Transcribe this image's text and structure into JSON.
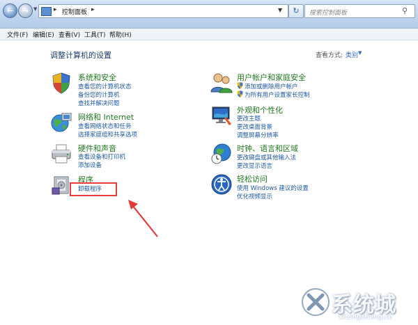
{
  "address_bar": {
    "path": "控制面板",
    "search_placeholder": "搜索控制面板"
  },
  "menu": [
    "文件(F)",
    "编辑(E)",
    "查看(V)",
    "工具(T)",
    "帮助(H)"
  ],
  "main": {
    "title": "调整计算机的设置",
    "view_by_label": "查看方式:",
    "view_by_value": "类别"
  },
  "categories": [
    {
      "title": "系统和安全",
      "icon": "shield-flag-icon",
      "links": [
        "查看您的计算机状态",
        "备份您的计算机",
        "查找并解决问题"
      ]
    },
    {
      "title": "网络和 Internet",
      "icon": "globe-network-icon",
      "links": [
        "查看网络状态和任务",
        "选择家庭组和共享选项"
      ]
    },
    {
      "title": "硬件和声音",
      "icon": "printer-icon",
      "links": [
        "查看设备和打印机",
        "添加设备"
      ]
    },
    {
      "title": "程序",
      "icon": "programs-icon",
      "links": [
        "卸载程序"
      ]
    },
    {
      "title": "用户帐户和家庭安全",
      "icon": "users-icon",
      "links": [
        "添加或删除用户帐户",
        "为所有用户设置家长控制"
      ]
    },
    {
      "title": "外观和个性化",
      "icon": "monitor-paint-icon",
      "links": [
        "更改主题",
        "更改桌面背景",
        "调整屏幕分辨率"
      ]
    },
    {
      "title": "时钟、语言和区域",
      "icon": "clock-globe-icon",
      "links": [
        "更改键盘或其他输入法",
        "更改显示语言"
      ]
    },
    {
      "title": "轻松访问",
      "icon": "ease-of-access-icon",
      "links": [
        "使用 Windows 建议的设置",
        "优化视频显示"
      ]
    }
  ],
  "watermark": {
    "text": "系统城",
    "sub": "xitongcheng.cc"
  },
  "colors": {
    "title_green": "#1f7a1f",
    "link_blue": "#1d5aa8",
    "highlight_red": "#e63c3c"
  }
}
